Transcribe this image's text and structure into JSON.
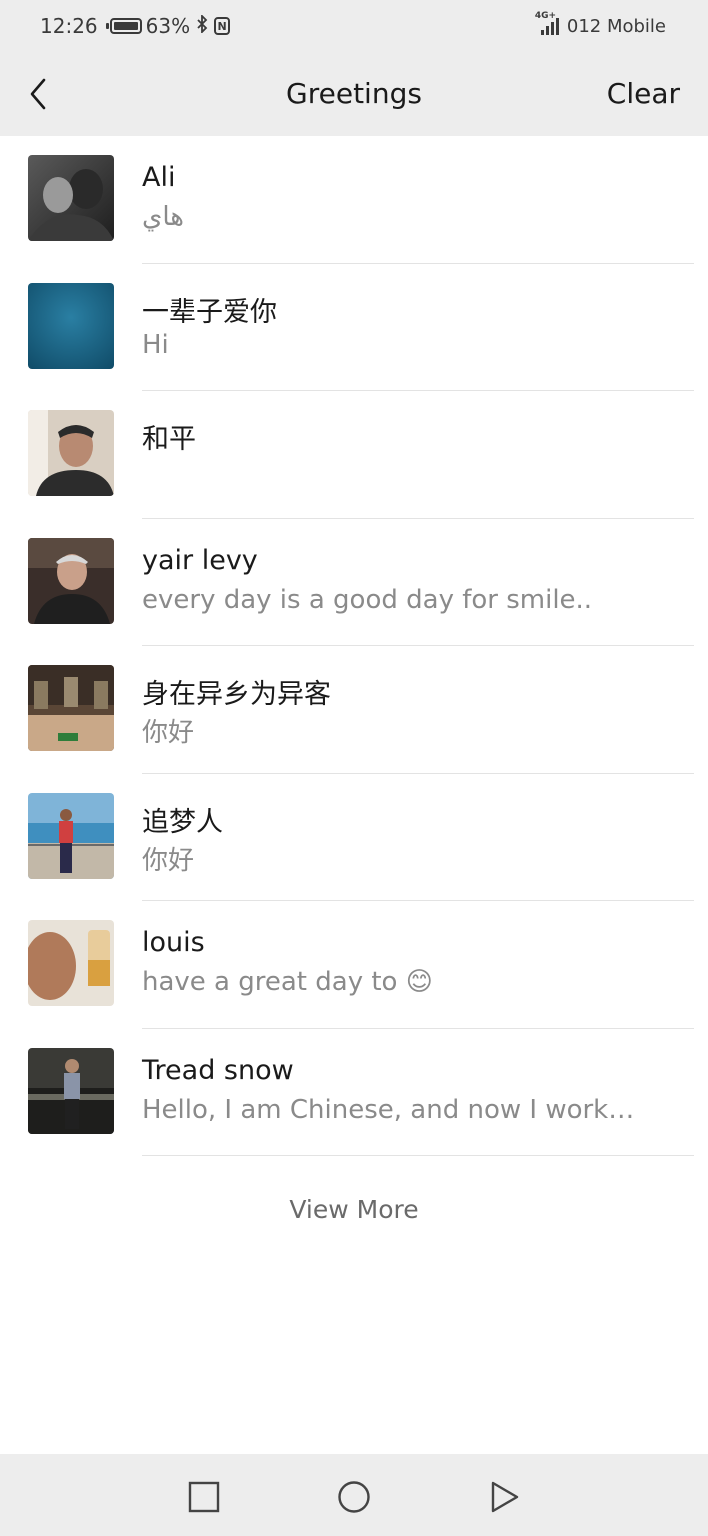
{
  "status_bar": {
    "time": "12:26",
    "battery": "63%",
    "network_type": "4G+",
    "carrier": "012 Mobile"
  },
  "header": {
    "title": "Greetings",
    "clear_label": "Clear"
  },
  "greetings": [
    {
      "name": "Ali",
      "message": "هاي"
    },
    {
      "name": "一辈子爱你",
      "message": "Hi"
    },
    {
      "name": "和平",
      "message": ""
    },
    {
      "name": "yair levy",
      "message": "every day is a good day for smile.."
    },
    {
      "name": "身在异乡为异客",
      "message": "你好"
    },
    {
      "name": "追梦人",
      "message": "你好"
    },
    {
      "name": "louis",
      "message": "have a great day to 😊"
    },
    {
      "name": "Tread snow",
      "message": "Hello, I am Chinese, and now I work…"
    }
  ],
  "view_more_label": "View More",
  "nav_bar": {
    "buttons": [
      "recent-apps",
      "home",
      "back"
    ]
  }
}
